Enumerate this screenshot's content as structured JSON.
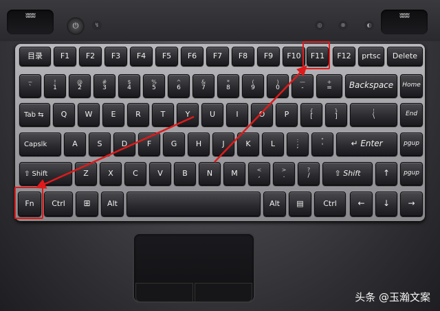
{
  "watermark": "头条 @玉瀚文案",
  "top": {
    "speaker_left": "ʬʬʬ",
    "speaker_right": "ʬʬʬ",
    "power": "⏻",
    "mini": [
      "↯",
      "◎",
      "⊗",
      "◐"
    ]
  },
  "row_fn": [
    "目录",
    "F1",
    "F2",
    "F3",
    "F4",
    "F5",
    "F6",
    "F7",
    "F8",
    "F9",
    "F10",
    "F11",
    "F12",
    "prtsc",
    "Delete"
  ],
  "row_num": [
    {
      "t": "~",
      "b": "`"
    },
    {
      "t": "!",
      "b": "1"
    },
    {
      "t": "@",
      "b": "2"
    },
    {
      "t": "#",
      "b": "3"
    },
    {
      "t": "$",
      "b": "4"
    },
    {
      "t": "%",
      "b": "5"
    },
    {
      "t": "^",
      "b": "6"
    },
    {
      "t": "&",
      "b": "7"
    },
    {
      "t": "*",
      "b": "8"
    },
    {
      "t": "(",
      "b": "9"
    },
    {
      "t": ")",
      "b": "0"
    },
    {
      "t": "—",
      "b": "-"
    },
    {
      "t": "+",
      "b": "="
    }
  ],
  "backspace": "Backspace",
  "home": "Home",
  "tab": "Tab ⇆",
  "row_q": [
    "Q",
    "W",
    "E",
    "R",
    "T",
    "Y",
    "U",
    "I",
    "O",
    "P"
  ],
  "row_q_pairs": [
    {
      "t": "{",
      "b": "["
    },
    {
      "t": "}",
      "b": "]"
    },
    {
      "t": "¦",
      "b": "\\"
    }
  ],
  "end": "End",
  "caps": "Capslk",
  "row_a": [
    "A",
    "S",
    "D",
    "F",
    "G",
    "H",
    "J",
    "K",
    "L"
  ],
  "row_a_pairs": [
    {
      "t": ":",
      "b": ";"
    },
    {
      "t": "\"",
      "b": "'"
    }
  ],
  "enter": "↵ Enter",
  "pgup": "pgup",
  "shift_l": "⇧ Shift",
  "row_z": [
    "Z",
    "X",
    "C",
    "V",
    "B",
    "N",
    "M"
  ],
  "row_z_pairs": [
    {
      "t": "<",
      "b": ","
    },
    {
      "t": ">",
      "b": "."
    },
    {
      "t": "?",
      "b": "/"
    }
  ],
  "shift_r": "⇧ Shift",
  "up": "↑",
  "pgdn": "pgup",
  "bottom": {
    "fn": "Fn",
    "ctrl_l": "Ctrl",
    "win": "⊞",
    "alt_l": "Alt",
    "alt_r": "Alt",
    "menu": "▤",
    "ctrl_r": "Ctrl",
    "left": "←",
    "down": "↓",
    "right": "→"
  }
}
